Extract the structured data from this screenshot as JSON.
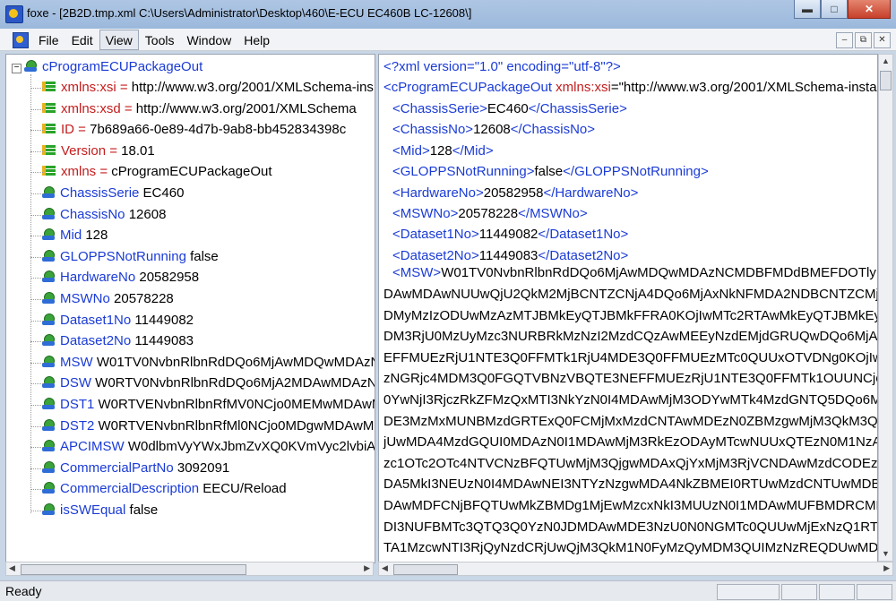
{
  "window": {
    "title": "foxe - [2B2D.tmp.xml  C:\\Users\\Administrator\\Desktop\\460\\E-ECU EC460B LC-12608\\]"
  },
  "menu": {
    "items": [
      "File",
      "Edit",
      "View",
      "Tools",
      "Window",
      "Help"
    ],
    "active": "View"
  },
  "tree": {
    "root": "cProgramECUPackageOut",
    "attributes": [
      {
        "name": "xmlns:xsi",
        "value": "http://www.w3.org/2001/XMLSchema-ins"
      },
      {
        "name": "xmlns:xsd",
        "value": "http://www.w3.org/2001/XMLSchema"
      },
      {
        "name": "ID",
        "value": "7b689a66-0e89-4d7b-9ab8-bb452834398c"
      },
      {
        "name": "Version",
        "value": "18.01"
      },
      {
        "name": "xmlns",
        "value": "cProgramECUPackageOut"
      }
    ],
    "elements": [
      {
        "name": "ChassisSerie",
        "value": "EC460"
      },
      {
        "name": "ChassisNo",
        "value": "12608"
      },
      {
        "name": "Mid",
        "value": "128"
      },
      {
        "name": "GLOPPSNotRunning",
        "value": "false"
      },
      {
        "name": "HardwareNo",
        "value": "20582958"
      },
      {
        "name": "MSWNo",
        "value": "20578228"
      },
      {
        "name": "Dataset1No",
        "value": "11449082"
      },
      {
        "name": "Dataset2No",
        "value": "11449083"
      },
      {
        "name": "MSW",
        "value": "W01TV0NvbnRlbnRdDQo6MjAwMDQwMDAzN"
      },
      {
        "name": "DSW",
        "value": "W0RTV0NvbnRlbnRdDQo6MjA2MDAwMDAzNz"
      },
      {
        "name": "DST1",
        "value": "W0RTVENvbnRlbnRfMV0NCjo0MEMwMDAwM"
      },
      {
        "name": "DST2",
        "value": "W0RTVENvbnRlbnRfMl0NCjo0MDgwMDAwMD"
      },
      {
        "name": "APCIMSW",
        "value": "W0dlbmVyYWxJbmZvXQ0KVmVyc2lvbiA9I"
      },
      {
        "name": "CommercialPartNo",
        "value": "3092091"
      },
      {
        "name": "CommercialDescription",
        "value": "EECU/Reload"
      },
      {
        "name": "isSWEqual",
        "value": "false"
      }
    ]
  },
  "source": {
    "decl": "<?xml version=\"1.0\" encoding=\"utf-8\"?>",
    "root_open": "<cProgramECUPackageOut",
    "root_attr": "xmlns:xsi",
    "root_eq": "=\"http://www.w3.org/2001/XMLSchema-instan",
    "tags": [
      {
        "tag": "ChassisSerie",
        "close": "ChassisSerie",
        "text": "EC460"
      },
      {
        "tag": "ChassisNo",
        "close": "ChassisNo",
        "text": "12608"
      },
      {
        "tag": "Mid",
        "close": "Mid",
        "text": "128"
      },
      {
        "tag": "GLOPPSNotRunning",
        "close": "GLOPPSNotRunning",
        "text": "false"
      },
      {
        "tag": "HardwareNo",
        "close": "HardwareNo",
        "text": "20582958"
      },
      {
        "tag": "MSWNo",
        "close": "MSWNo",
        "text": "20578228"
      },
      {
        "tag": "Dataset1No",
        "close": "Dataset1No",
        "text": "11449082"
      },
      {
        "tag": "Dataset2No",
        "close": "Dataset2No",
        "text": "11449083"
      }
    ],
    "msw_open": "<MSW>",
    "msw_first": "W01TV0NvbnRlbnRdDQo6MjAwMDQwMDAzNCMDBFMDdBMEFDOTly",
    "msw_lines": [
      "DAwMDAwNUUwQjU2QkM2MjBCNTZCNjA4DQo6MjAxNkNFMDA2NDBCNTZCMjY",
      "DMyMzIzODUwMzAzMTJBMkEyQTJBMkFFRA0KOjIwMTc2RTAwMkEyQTJBMkEyQTJB",
      "DM3RjU0MzUyMzc3NURBRkMzNzI2MzdCQzAwMEEyNzdEMjdGRUQwDQo6MjAxMI",
      "EFFMUEzRjU1NTE3Q0FFMTk1RjU4MDE3Q0FFMUEzMTc0QUUxOTVDNg0KOjIwMTB",
      "zNGRjc4MDM3Q0FGQTVBNzVBQTE3NEFFMUEzRjU1NTE3Q0FFMTk1OUUNCjoyMD",
      "0YwNjI3RjczRkZFMzQxMTI3NkYzN0I4MDAwMjM3ODYwMTk4MzdGNTQ5DQo6MjA",
      "DE3MzMxMUNBMzdGRTExQ0FCMjMxMzdCNTAwMDEzN0ZBMzgwMjM3QkM3QgC",
      "jUwMDA4MzdGQUI0MDAzN0I1MDAwMjM3RkEzODAyMTcwNUUxQTEzN0M1NzAN",
      "zc1OTc2OTc4NTVCNzBFQTUwMjM3QjgwMDAxQjYxMjM3RjVCNDAwMzdCODEzDQ",
      "DA5MkI3NEUzN0I4MDAwNEI3NTYzNzgwMDA4NkZBMEI0RTUwMzdCNTUwMDBGR",
      "DAwMDFCNjBFQTUwMkZBMDg1MjEwMzcxNkI3MUUzN0I1MDAwMUFBMDRCMDE",
      "DI3NUFBMTc3QTQ3Q0YzN0JDMDAwMDE3NzU0N0NGMTc0QUUwMjExNzQ1RTAy",
      "TA1MzcwNTI3RjQyNzdCRjUwQjM3QkM1N0FyMzQyMDM3QUIMzNzREQDUwMDM1"
    ]
  },
  "status": {
    "text": "Ready"
  }
}
